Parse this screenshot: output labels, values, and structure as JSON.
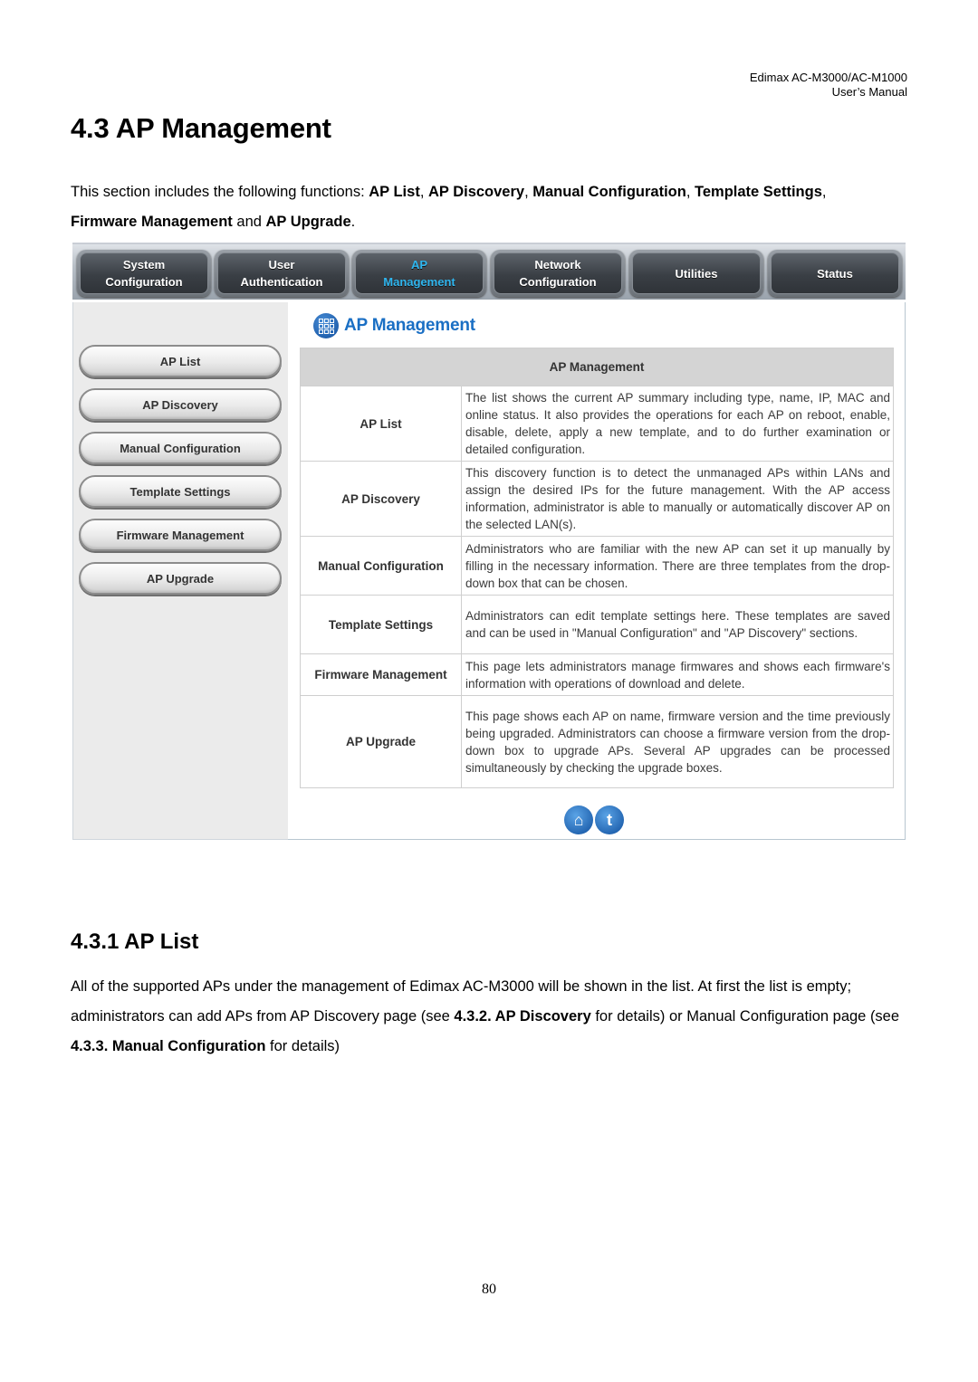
{
  "header": {
    "line1": "Edimax  AC-M3000/AC-M1000",
    "line2": "User’s  Manual"
  },
  "section": {
    "title": "4.3 AP Management",
    "intro_prefix": "This section includes the following functions: ",
    "functions": [
      "AP List",
      "AP Discovery",
      "Manual Configuration",
      "Template Settings",
      "Firmware Management",
      "AP Upgrade"
    ],
    "sep_comma": ", ",
    "sep_and": " and ",
    "end": "."
  },
  "screenshot": {
    "topnav": [
      {
        "line1": "System",
        "line2": "Configuration",
        "active": false
      },
      {
        "line1": "User",
        "line2": "Authentication",
        "active": false
      },
      {
        "line1": "AP",
        "line2": "Management",
        "active": true
      },
      {
        "line1": "Network",
        "line2": "Configuration",
        "active": false
      },
      {
        "line1": "Utilities",
        "line2": "",
        "active": false
      },
      {
        "line1": "Status",
        "line2": "",
        "active": false
      }
    ],
    "sidebar": [
      "AP List",
      "AP Discovery",
      "Manual Configuration",
      "Template Settings",
      "Firmware Management",
      "AP Upgrade"
    ],
    "pane_title": "AP Management",
    "pane_icon": "grid-icon",
    "table": {
      "header": "AP Management",
      "rows": [
        {
          "name": "AP List",
          "desc": "The list shows the current AP summary including type, name, IP, MAC and online status. It also provides the operations for each AP on reboot, enable, disable, delete, apply a new template, and to do further examination or detailed configuration."
        },
        {
          "name": "AP Discovery",
          "desc": "This discovery function is to detect the unmanaged APs within LANs and assign the desired IPs for the future management. With the AP access information, administrator is able to manually or automatically discover AP on the selected LAN(s)."
        },
        {
          "name": "Manual Configuration",
          "desc": "Administrators who are familiar with the new AP can set it up manually by filling in the necessary information. There are three templates from the drop-down box that can be chosen."
        },
        {
          "name": "Template Settings",
          "desc": "Administrators can edit template settings here. These templates are saved and can be used in \"Manual Configuration\" and \"AP Discovery\" sections."
        },
        {
          "name": "Firmware Management",
          "desc": "This page lets administrators manage firmwares and shows each firmware's information with operations of download and delete."
        },
        {
          "name": "AP Upgrade",
          "desc": "This page shows each AP on name, firmware version and the time previously being upgraded. Administrators can choose a firmware version from the drop-down box to upgrade APs. Several AP upgrades can be processed simultaneously by checking the upgrade boxes."
        }
      ]
    },
    "bottom_icons": [
      {
        "name": "home-icon",
        "glyph": "⌂"
      },
      {
        "name": "top-icon",
        "glyph": "t"
      }
    ]
  },
  "subsection": {
    "title": "4.3.1  AP List",
    "p1": "All of the supported APs under the management of Edimax AC-M3000 will be shown in the list. At first the list is empty; administrators can add APs from AP Discovery page (see ",
    "ref1": "4.3.2. AP Discovery",
    "p2": " for details) or Manual Configuration page (see ",
    "ref2": "4.3.3. Manual Configuration",
    "p3": " for details)"
  },
  "page_number": "80"
}
